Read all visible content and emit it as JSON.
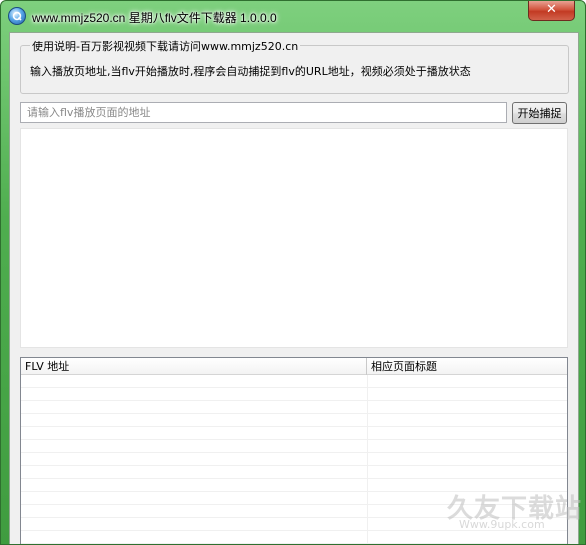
{
  "window": {
    "title": "www.mmjz520.cn 星期八flv文件下载器 1.0.0.0",
    "close_glyph": "✕"
  },
  "instructions": {
    "legend": "使用说明-百万影视视频下载请访问www.mmjz520.cn",
    "text": "输入播放页地址,当flv开始播放时,程序会自动捕捉到flv的URL地址，视频必须处于播放状态"
  },
  "url_input": {
    "placeholder": "请输入flv播放页面的地址",
    "value": ""
  },
  "start_button": {
    "label": "开始捕捉"
  },
  "list": {
    "columns": [
      "FLV 地址",
      "相应页面标题"
    ],
    "rows": []
  },
  "watermark": {
    "main": "久友下载站",
    "sub": "Www.9upk.com"
  },
  "colors": {
    "frame": "#4fae4f",
    "client": "#f0f0f0",
    "close": "#c23a23"
  }
}
